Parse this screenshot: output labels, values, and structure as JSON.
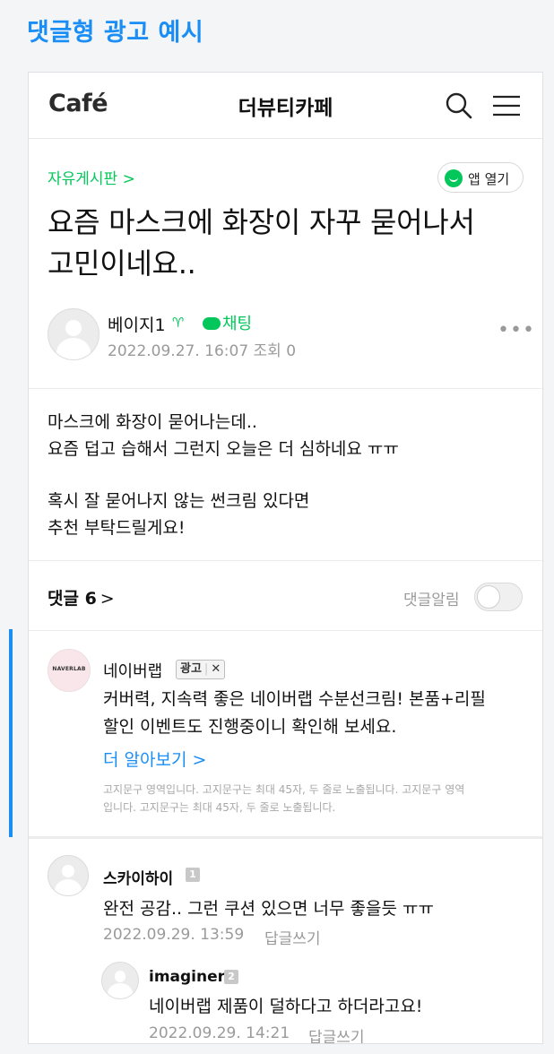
{
  "page_heading": "댓글형 광고 예시",
  "header": {
    "logo": "Café",
    "cafe_name": "더뷰티카페",
    "icons": [
      "search-icon",
      "menu-icon"
    ]
  },
  "post": {
    "board": "자유게시판 >",
    "app_open_label": "앱 열기",
    "title_line1": "요즘 마스크에 화장이 자꾸 묻어나서",
    "title_line2": "고민이네요..",
    "author": "베이지1",
    "chat_label": "채팅",
    "meta": "2022.09.27. 16:07  조회 0",
    "more": "•••",
    "body": [
      "마스크에 화장이 묻어나는데..",
      "요즘 덥고 습해서 그런지 오늘은 더 심하네요 ㅠㅠ",
      "",
      "혹시 잘 묻어나지 않는 썬크림 있다면",
      "추천 부탁드릴게요!"
    ]
  },
  "comments_bar": {
    "label": "댓글 6",
    "chevron": ">",
    "alarm_label": "댓글알림",
    "alarm_on": false
  },
  "ad": {
    "logo_text": "NAVERLAB",
    "name": "네이버랩",
    "badge": "광고",
    "badge_close": "✕",
    "text_line1": "커버력, 지속력 좋은 네이버랩 수분선크림! 본품+리필",
    "text_line2": "할인 이벤트도 진행중이니 확인해 보세요.",
    "more_label": "더 알아보기 >",
    "notice_line1": "고지문구 영역입니다. 고지문구는 최대 45자, 두 줄로 노출됩니다. 고지문구 영역",
    "notice_line2": "입니다. 고지문구는 최대 45자, 두 줄로 노출됩니다."
  },
  "comments": [
    {
      "name": "스카이하이",
      "badge": "1",
      "text": "완전 공감.. 그런 쿠션 있으면 너무 좋을듯 ㅠㅠ",
      "date": "2022.09.29. 13:59",
      "reply_label": "답글쓰기"
    },
    {
      "name": "imaginer",
      "badge": "2",
      "text": "네이버랩 제품이 덜하다고 하더라고요!",
      "date": "2022.09.29. 14:21",
      "reply_label": "답글쓰기"
    }
  ],
  "colors": {
    "heading_blue": "#1a8ef5",
    "naver_green": "#03c75a",
    "muted_gray": "#9a9a9a"
  }
}
